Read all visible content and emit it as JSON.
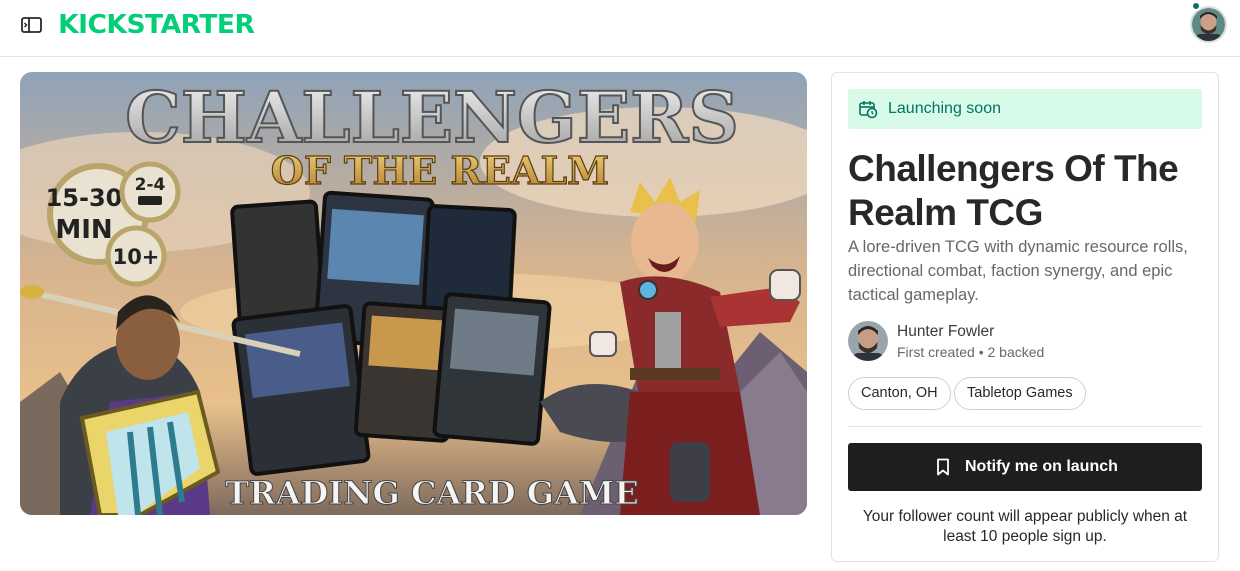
{
  "nav": {
    "logo_text": "KICKSTARTER",
    "logo_color": "#05ce78",
    "sidebar_icon": "sidebar-toggle-icon",
    "avatar": "user-avatar",
    "notification_dot_color": "#037362"
  },
  "hero": {
    "title_line1": "CHALLENGERS",
    "title_line2": "OF THE REALM",
    "playtime": "15-30",
    "playtime_unit": "MIN",
    "players": "2-4",
    "age": "10+",
    "footer": "TRADING CARD GAME"
  },
  "panel": {
    "status": "Launching soon",
    "status_icon": "calendar-clock-icon",
    "status_bg": "#d8fae8",
    "status_color": "#037362",
    "title": "Challengers Of The Realm TCG",
    "blurb": "A lore-driven TCG with dynamic resource rolls, directional combat, faction synergy, and epic tactical gameplay.",
    "creator": {
      "name": "Hunter Fowler",
      "meta": "First created • 2 backed"
    },
    "tags": {
      "location": "Canton, OH",
      "category": "Tabletop Games"
    },
    "notify_button": "Notify me on launch",
    "notify_icon": "bookmark-icon",
    "follower_note": "Your follower count will appear publicly when at least 10 people sign up."
  }
}
